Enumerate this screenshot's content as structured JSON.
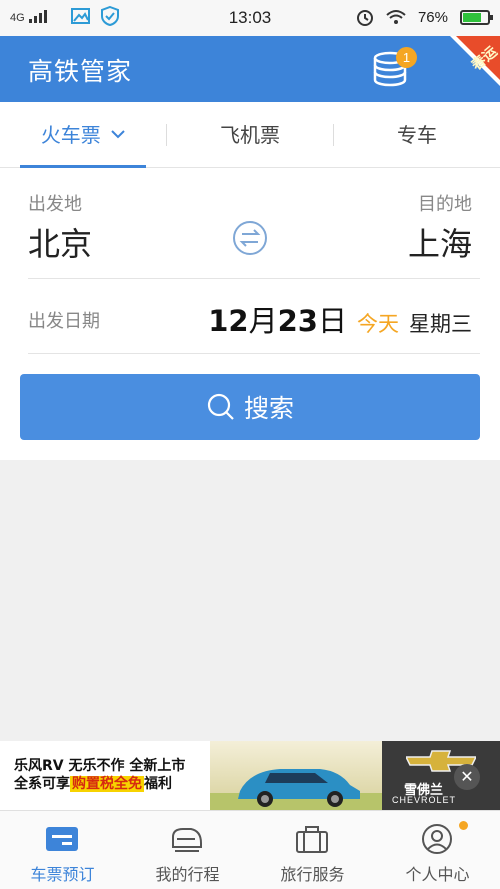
{
  "status_bar": {
    "network": "4G",
    "time": "13:03",
    "battery": "76%",
    "battery_level": 0.76,
    "icons": [
      "signal-icon",
      "image-icon",
      "shield-icon",
      "alarm-icon",
      "wifi-icon",
      "battery-icon"
    ]
  },
  "header": {
    "title": "高铁管家",
    "badge_count": "1",
    "corner_label": "春运",
    "coins_icon": "coins-icon"
  },
  "tabs": [
    {
      "label": "火车票",
      "active": true
    },
    {
      "label": "飞机票",
      "active": false
    },
    {
      "label": "专车",
      "active": false
    }
  ],
  "form": {
    "origin_label": "出发地",
    "origin_city": "北京",
    "dest_label": "目的地",
    "dest_city": "上海",
    "date_label": "出发日期",
    "date_month": "12",
    "date_month_unit": "月",
    "date_day": "23",
    "date_day_unit": "日",
    "today": "今天",
    "weekday": "星期三"
  },
  "search": {
    "label": "搜索"
  },
  "ad": {
    "line1": "乐风RV 无乐不作 全新上市",
    "line2_prefix": "全系可享",
    "line2_highlight": "购置税全免",
    "line2_suffix": "福利",
    "brand_name": "雪佛兰",
    "brand_sub": "CHEVROLET",
    "close": "✕"
  },
  "bottom_nav": [
    {
      "label": "车票预订",
      "active": true,
      "icon": "ticket-icon"
    },
    {
      "label": "我的行程",
      "active": false,
      "icon": "train-icon"
    },
    {
      "label": "旅行服务",
      "active": false,
      "icon": "luggage-icon"
    },
    {
      "label": "个人中心",
      "active": false,
      "icon": "user-icon"
    }
  ],
  "colors": {
    "primary": "#3d84d9",
    "accent": "#f5a623",
    "button": "#4a8ee0"
  }
}
